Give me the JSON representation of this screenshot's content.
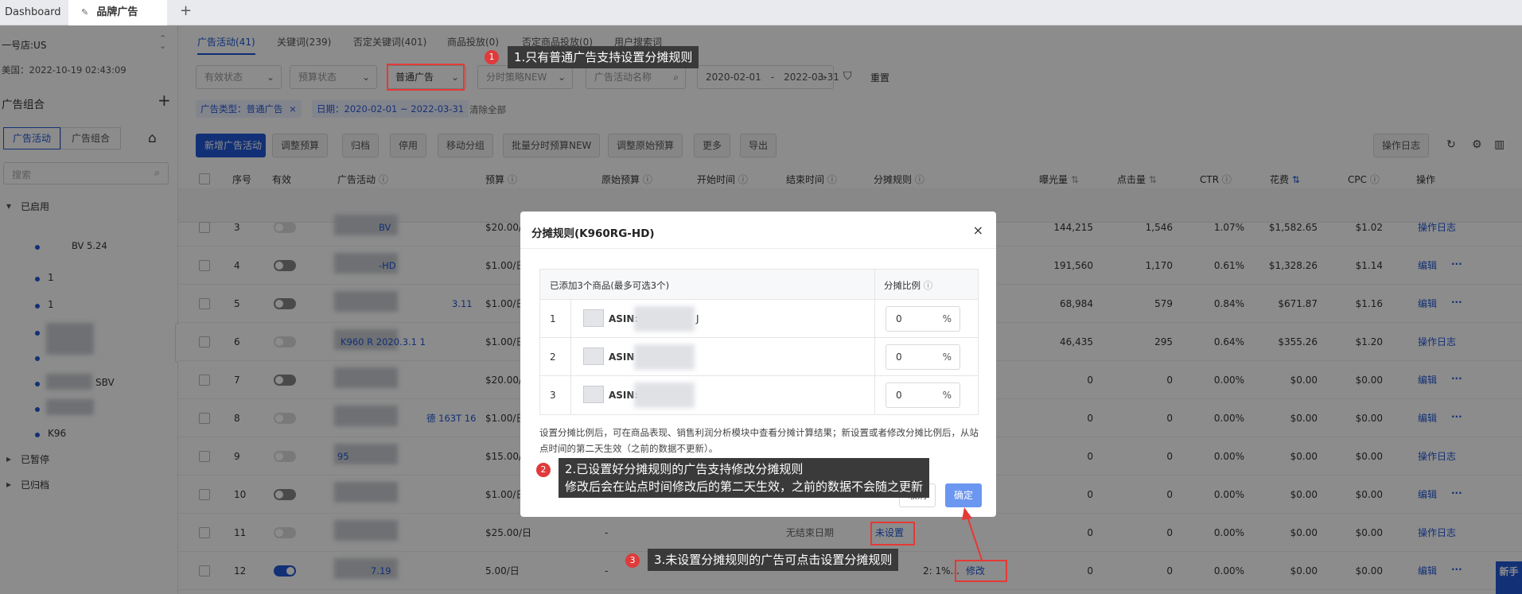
{
  "tabs": [
    {
      "label": "Dashboard"
    },
    {
      "label": "品牌广告"
    }
  ],
  "sidebar": {
    "store": "一号店:US",
    "datetime": "美国：2022-10-19 02:43:09",
    "section": "广告组合",
    "tab_campaigns": "广告活动",
    "tab_portfolios": "广告组合",
    "search_placeholder": "搜索",
    "tree": {
      "enabled": "已启用",
      "paused": "已暂停",
      "archived": "已归档",
      "items": [
        "BV 5.24",
        "1",
        "1",
        "",
        "",
        "SBV",
        "",
        "K96"
      ]
    },
    "collapse": "收起"
  },
  "main": {
    "subtabs": [
      "广告活动(41)",
      "关键词(239)",
      "否定关键词(401)",
      "商品投放(0)",
      "否定商品投放(0)",
      "用户搜索词"
    ],
    "filters": {
      "status": "有效状态",
      "budget": "预算状态",
      "type": "普通广告",
      "schedule": "分时策略NEW",
      "name_placeholder": "广告活动名称",
      "date_from": "2020-02-01",
      "date_sep": "-",
      "date_to": "2022-03-31",
      "reset": "重置"
    },
    "chips": [
      "广告类型：普通广告",
      "日期：2020-02-01 ~ 2022-03-31"
    ],
    "clear_all": "清除全部",
    "actions": [
      "新增广告活动",
      "调整预算",
      "归档",
      "停用",
      "移动分组",
      "批量分时预算NEW",
      "调整原始预算",
      "更多",
      "导出"
    ],
    "oplog_btn": "操作日志",
    "columns": [
      "序号",
      "有效",
      "广告活动",
      "预算",
      "原始预算",
      "开始时间",
      "结束时间",
      "分摊规则",
      "曝光量",
      "点击量",
      "CTR",
      "花费",
      "CPC",
      "操作"
    ],
    "rows": [
      {
        "no": "3",
        "toggle": "off",
        "name": "BV",
        "budget": "$20.00/日",
        "imp": "144,215",
        "clk": "1,546",
        "ctr": "1.07%",
        "spend": "$1,582.65",
        "cpc": "$1.02",
        "op": "操作日志",
        "more": ""
      },
      {
        "no": "4",
        "toggle": "gray",
        "name": "-HD",
        "budget": "$1.00/日",
        "imp": "191,560",
        "clk": "1,170",
        "ctr": "0.61%",
        "spend": "$1,328.26",
        "cpc": "$1.14",
        "op": "编辑",
        "more": "···"
      },
      {
        "no": "5",
        "toggle": "gray",
        "name": "3.11",
        "budget": "$1.00/日",
        "imp": "68,984",
        "clk": "579",
        "ctr": "0.84%",
        "spend": "$671.87",
        "cpc": "$1.16",
        "op": "编辑",
        "more": "···"
      },
      {
        "no": "6",
        "toggle": "off",
        "name": "K960 R 2020.3.1 1",
        "budget": "$1.00/日",
        "imp": "46,435",
        "clk": "295",
        "ctr": "0.64%",
        "spend": "$355.26",
        "cpc": "$1.20",
        "op": "操作日志",
        "more": ""
      },
      {
        "no": "7",
        "toggle": "gray",
        "name": "",
        "budget": "$20.00/日",
        "imp": "0",
        "clk": "0",
        "ctr": "0.00%",
        "spend": "$0.00",
        "cpc": "$0.00",
        "op": "编辑",
        "more": "···"
      },
      {
        "no": "8",
        "toggle": "off",
        "name": "德 163T 16",
        "budget": "$1.00/日",
        "imp": "0",
        "clk": "0",
        "ctr": "0.00%",
        "spend": "$0.00",
        "cpc": "$0.00",
        "op": "编辑",
        "more": "···"
      },
      {
        "no": "9",
        "toggle": "off",
        "name": "95",
        "budget": "$15.00/日",
        "imp": "0",
        "clk": "0",
        "ctr": "0.00%",
        "spend": "$0.00",
        "cpc": "$0.00",
        "op": "操作日志",
        "more": ""
      },
      {
        "no": "10",
        "toggle": "gray",
        "name": "",
        "budget": "$1.00/日",
        "imp": "0",
        "clk": "0",
        "ctr": "0.00%",
        "spend": "$0.00",
        "cpc": "$0.00",
        "op": "编辑",
        "more": "···"
      },
      {
        "no": "11",
        "toggle": "off",
        "name": "",
        "budget": "$25.00/日",
        "orig": "-",
        "end": "无结束日期",
        "rule": "未设置",
        "imp": "0",
        "clk": "0",
        "ctr": "0.00%",
        "spend": "$0.00",
        "cpc": "$0.00",
        "op": "操作日志",
        "more": ""
      },
      {
        "no": "12",
        "toggle": "on",
        "name": "7.19",
        "budget": "5.00/日",
        "orig": "-",
        "rule_prefix": "2: 1%...",
        "rule": "修改",
        "imp": "0",
        "clk": "0",
        "ctr": "0.00%",
        "spend": "$0.00",
        "cpc": "$0.00",
        "op": "编辑",
        "more": "···"
      }
    ],
    "new_badge": "新手"
  },
  "modal": {
    "title": "分摊规则(K960RG-HD)",
    "col_added": "已添加3个商品(最多可选3个)",
    "col_ratio": "分摊比例",
    "items": [
      {
        "no": "1",
        "asin": "ASIN:",
        "suffix": "J",
        "value": "0",
        "unit": "%"
      },
      {
        "no": "2",
        "asin": "ASIN",
        "suffix": "",
        "value": "0",
        "unit": "%"
      },
      {
        "no": "3",
        "asin": "ASIN:",
        "suffix": "",
        "value": "0",
        "unit": "%"
      }
    ],
    "note": "设置分摊比例后，可在商品表现、销售利润分析模块中查看分摊计算结果；新设置或者修改分摊比例后，从站点时间的第二天生效（之前的数据不更新）。",
    "cancel": "取消",
    "confirm": "确定"
  },
  "callouts": [
    {
      "num": "1",
      "text": "1.只有普通广告支持设置分摊规则"
    },
    {
      "num": "2",
      "line1": "2.已设置好分摊规则的广告支持修改分摊规则",
      "line2": "修改后会在站点时间修改后的第二天生效，之前的数据不会随之更新"
    },
    {
      "num": "3",
      "text": "3.未设置分摊规则的广告可点击设置分摊规则"
    }
  ],
  "colors": {
    "accent": "#2158d8",
    "annotation": "#e53935"
  }
}
